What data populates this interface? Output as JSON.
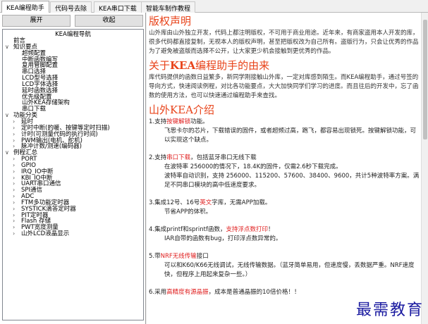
{
  "tabs": [
    "KEA编程助手",
    "代码号去除",
    "KEA串口下载",
    "智能车制作教程"
  ],
  "buttons": {
    "expand": "展开",
    "collapse": "收起"
  },
  "tree": {
    "title": "KEA编程导航",
    "items": [
      {
        "level": 1,
        "label": "前言",
        "arrow": ""
      },
      {
        "level": 0,
        "label": "知识要点",
        "arrow": "v"
      },
      {
        "level": 2,
        "label": "超频配置",
        "arrow": ""
      },
      {
        "level": 2,
        "label": "中断函数编写",
        "arrow": ""
      },
      {
        "level": 2,
        "label": "复用管脚配置",
        "arrow": ""
      },
      {
        "level": 2,
        "label": "串口选择",
        "arrow": ""
      },
      {
        "level": 2,
        "label": "LCD型号选择",
        "arrow": ""
      },
      {
        "level": 2,
        "label": "LCD字体选择",
        "arrow": ""
      },
      {
        "level": 2,
        "label": "延时函数选择",
        "arrow": ""
      },
      {
        "level": 2,
        "label": "优先级配置",
        "arrow": ""
      },
      {
        "level": 2,
        "label": "山外KEA存储架构",
        "arrow": ""
      },
      {
        "level": 2,
        "label": "串口下载",
        "arrow": ""
      },
      {
        "level": 0,
        "label": "功能分类",
        "arrow": "v"
      },
      {
        "level": 1,
        "label": "延时",
        "arrow": ">"
      },
      {
        "level": 1,
        "label": "定时中断(的暖、按键等定时扫描)",
        "arrow": ">"
      },
      {
        "level": 1,
        "label": "计时(可测量代码的执行时间)",
        "arrow": ">"
      },
      {
        "level": 1,
        "label": "PWM输出(电机、舵机)",
        "arrow": ">"
      },
      {
        "level": 1,
        "label": "脉冲计数/测速(编码器)",
        "arrow": ">"
      },
      {
        "level": 0,
        "label": "例程汇总",
        "arrow": "v"
      },
      {
        "level": 1,
        "label": "PORT",
        "arrow": ">"
      },
      {
        "level": 1,
        "label": "GPIO",
        "arrow": ">"
      },
      {
        "level": 1,
        "label": "IRQ_IO中断",
        "arrow": ">"
      },
      {
        "level": 1,
        "label": "KBI_IO中断",
        "arrow": ">"
      },
      {
        "level": 1,
        "label": "UART串口通信",
        "arrow": ">"
      },
      {
        "level": 1,
        "label": "SPI通信",
        "arrow": ">"
      },
      {
        "level": 1,
        "label": "ADC",
        "arrow": ">"
      },
      {
        "level": 1,
        "label": "FTM多功能定时器",
        "arrow": ">"
      },
      {
        "level": 1,
        "label": "SYSTICK滴答定时器",
        "arrow": ">"
      },
      {
        "level": 1,
        "label": "PIT定时器",
        "arrow": ">"
      },
      {
        "level": 1,
        "label": "Flash 存储",
        "arrow": ">"
      },
      {
        "level": 1,
        "label": "PWT宽度测量",
        "arrow": ">"
      },
      {
        "level": 1,
        "label": "山外LCD液晶显示",
        "arrow": ">"
      }
    ]
  },
  "content": {
    "copyright_title": "版权声明",
    "copyright_text": "山外库由山外独立开发，代码上都注明版权，不可用于商业用途。近年来，有商家盗用本人开发的库，很多代码都直接复制，无视本人的版权声明，甚至把版权改为自己所有。",
    "copyright_text2": "盗版行为，只会让优秀的作品为了避免被盗版而选择不公开，让大家更少机会接触到更优秀的作品。",
    "about_title_prefix": "关于",
    "about_title_bold": "KEA",
    "about_title_suffix": "编程助手的由来",
    "about_text": "库代码提供的函数日益繁多，新同学刚接触山外库，一定对库感到陌生。而KEA编程助手，通过号签的导向方式，快速阅读例程，对比各功能要点，大大加快同学们学习的进度。而且往后的开发中，忘了函数的使用方法，也可以快速通过编程助手来查找。",
    "intro_title": "山外KEA介绍",
    "items": [
      {
        "line1_a": "1.支持",
        "line1_red": "按键解锁",
        "line1_b": "功能。",
        "line2": "飞思卡尔的芯片，下载错误的固件，或者超频过高，跑飞，都容易出现锁死。按键解锁功能，可以实现这个缺点。"
      },
      {
        "line1_a": "2.支持",
        "line1_red": "串口下载",
        "line1_b": "，包括蓝牙串口无线下载",
        "line2": "在波特率 256000的情况下，18.4K的固件，仅需2.6秒下载完成。",
        "line3": "波特率自动识别，支持 256000、115200、57600、38400、9600，共计5种波特率方案。满足不同串口模块的高中低速度要求。"
      },
      {
        "line1_a": "3.集成12号、16号",
        "line1_red": "英文",
        "line1_b": "字库，无需APP加载。",
        "line2": "节省APP的体积。"
      },
      {
        "line1_a": "4.集成printf和sprintf函数，",
        "line1_red": "支持浮点数打印",
        "line1_b": "！",
        "line2": "IAR自带的函数有bug，打印浮点数异常的。"
      },
      {
        "line1_a": "5.带",
        "line1_red": "NRF无线传输",
        "line1_b": "接口",
        "line2": "可以和K60/K66无线调试，无线传输数据。（蓝牙简单易用，但速度慢，丢数据严重。NRF速度快，但程序上用起来复杂一些。）"
      },
      {
        "line1_a": "6.采用",
        "line1_red": "高精度有源晶振",
        "line1_b": "，成本是普通晶振的10倍价格！！"
      }
    ]
  },
  "watermark": "最需教育"
}
